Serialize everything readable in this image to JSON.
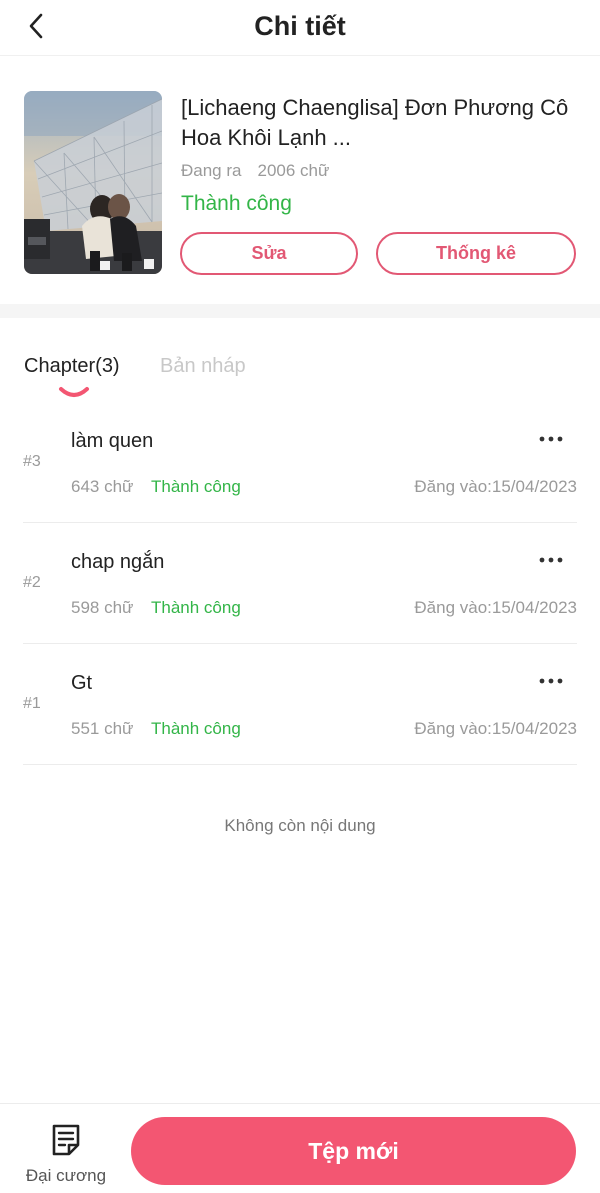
{
  "header": {
    "title": "Chi tiết"
  },
  "book": {
    "title": "[Lichaeng Chaenglisa] Đơn Phương Cô Hoa Khôi Lạnh ...",
    "status_label": "Đang ra",
    "word_count": "2006 chữ",
    "review_status": "Thành công",
    "edit_label": "Sửa",
    "stats_label": "Thống kê"
  },
  "tabs": {
    "chapters": "Chapter(3)",
    "drafts": "Bản nháp"
  },
  "chapters": [
    {
      "num": "#3",
      "title": "làm quen",
      "words": "643 chữ",
      "status": "Thành công",
      "date": "Đăng vào:15/04/2023"
    },
    {
      "num": "#2",
      "title": "chap ngắn",
      "words": "598 chữ",
      "status": "Thành công",
      "date": "Đăng vào:15/04/2023"
    },
    {
      "num": "#1",
      "title": "Gt",
      "words": "551 chữ",
      "status": "Thành công",
      "date": "Đăng vào:15/04/2023"
    }
  ],
  "list_end": "Không còn nội dung",
  "bottom": {
    "outline_label": "Đại cương",
    "new_label": "Tệp mới"
  },
  "colors": {
    "accent": "#f35672",
    "outline_accent": "#e25874",
    "success": "#33b548",
    "muted": "#9a9a9a"
  },
  "icons": {
    "back": "chevron-left-icon",
    "more": "more-horizontal-icon",
    "outline": "document-lines-icon"
  }
}
